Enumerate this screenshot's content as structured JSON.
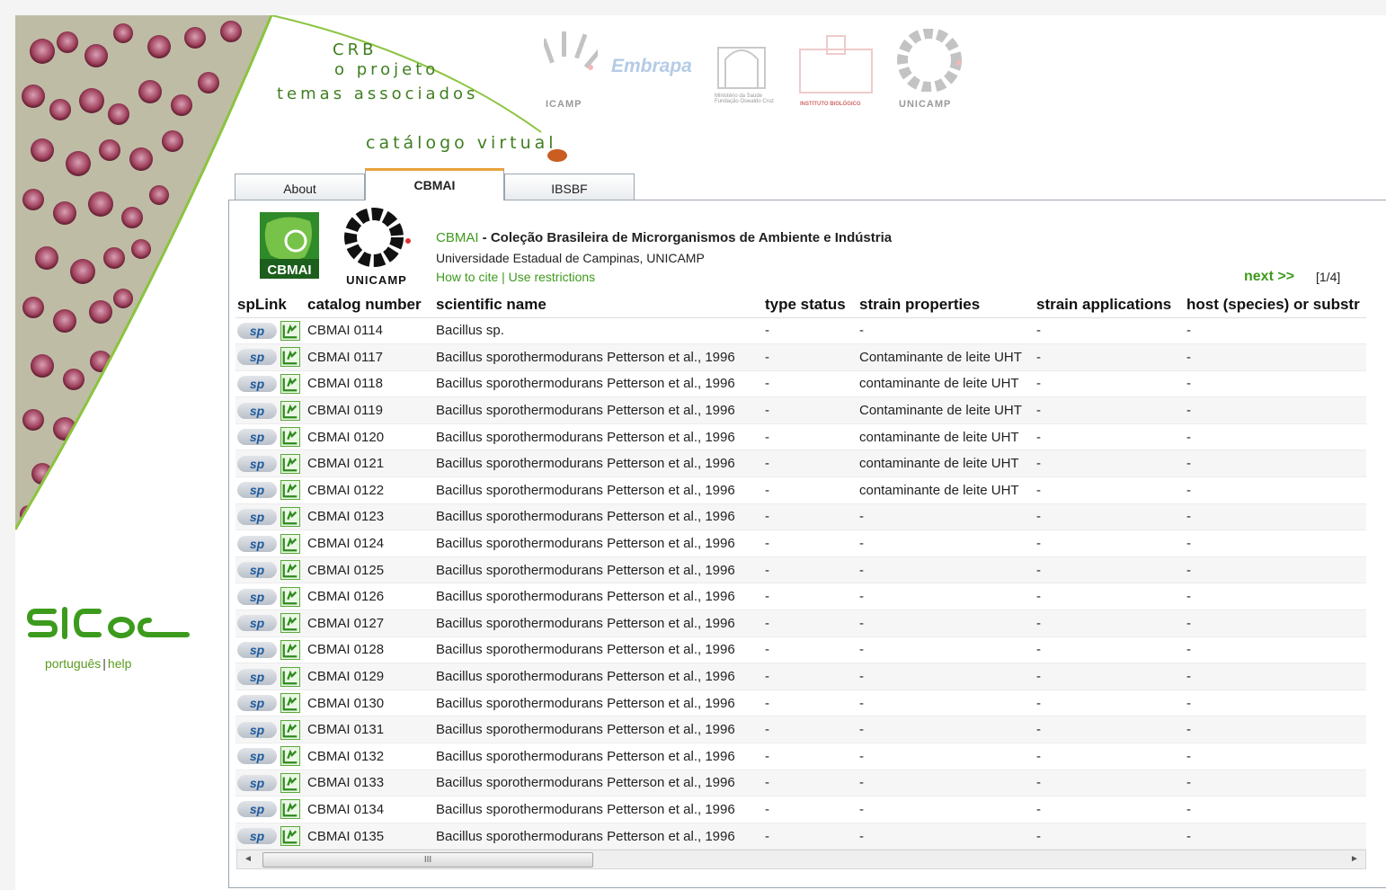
{
  "menu": {
    "crb": "CRB",
    "projeto": "o projeto",
    "temas": "temas associados",
    "catalogo": "catálogo virtual"
  },
  "partners": [
    {
      "name": "icamp",
      "label": "ICAMP"
    },
    {
      "name": "embrapa",
      "label": "Embrapa"
    },
    {
      "name": "ministerio-saude",
      "label": "Ministério da Saúde Fundação Oswaldo Cruz"
    },
    {
      "name": "instituto-biologico",
      "label": "INSTITUTO BIOLÓGICO"
    },
    {
      "name": "unicamp",
      "label": "UNICAMP"
    }
  ],
  "sidebar": {
    "logo_text": "SICol",
    "lang": "português",
    "help": "help",
    "sep": "|"
  },
  "tabs": [
    {
      "label": "About",
      "active": false
    },
    {
      "label": "CBMAI",
      "active": true
    },
    {
      "label": "IBSBF",
      "active": false
    }
  ],
  "collection": {
    "logo1": "CBMAI",
    "logo2": "UNICAMP",
    "acronym": "CBMAI",
    "title": " - Coleção Brasileira de Microrganismos de Ambiente e Indústria",
    "institution": "Universidade Estadual de Campinas, UNICAMP",
    "cite": "How to cite",
    "sep": "|",
    "restrictions": "Use restrictions",
    "next": "next >>",
    "page": "[1/4]"
  },
  "colors": {
    "accent": "#3f9a1c",
    "tab_highlight": "#e9a23b"
  },
  "table": {
    "headers": [
      "spLink",
      "catalog number",
      "scientific name",
      "type status",
      "strain properties",
      "strain applications",
      "host (species) or substr"
    ],
    "sp_label": "sp",
    "rows": [
      [
        "CBMAI 0114",
        "Bacillus sp.",
        "-",
        "-",
        "-",
        "-"
      ],
      [
        "CBMAI 0117",
        "Bacillus sporothermodurans Petterson et al., 1996",
        "-",
        "Contaminante de leite UHT",
        "-",
        "-"
      ],
      [
        "CBMAI 0118",
        "Bacillus sporothermodurans Petterson et al., 1996",
        "-",
        "contaminante de leite UHT",
        "-",
        "-"
      ],
      [
        "CBMAI 0119",
        "Bacillus sporothermodurans Petterson et al., 1996",
        "-",
        "Contaminante de leite UHT",
        "-",
        "-"
      ],
      [
        "CBMAI 0120",
        "Bacillus sporothermodurans Petterson et al., 1996",
        "-",
        "contaminante de leite UHT",
        "-",
        "-"
      ],
      [
        "CBMAI 0121",
        "Bacillus sporothermodurans Petterson et al., 1996",
        "-",
        "contaminante de leite UHT",
        "-",
        "-"
      ],
      [
        "CBMAI 0122",
        "Bacillus sporothermodurans Petterson et al., 1996",
        "-",
        "contaminante de leite UHT",
        "-",
        "-"
      ],
      [
        "CBMAI 0123",
        "Bacillus sporothermodurans Petterson et al., 1996",
        "-",
        "-",
        "-",
        "-"
      ],
      [
        "CBMAI 0124",
        "Bacillus sporothermodurans Petterson et al., 1996",
        "-",
        "-",
        "-",
        "-"
      ],
      [
        "CBMAI 0125",
        "Bacillus sporothermodurans Petterson et al., 1996",
        "-",
        "-",
        "-",
        "-"
      ],
      [
        "CBMAI 0126",
        "Bacillus sporothermodurans Petterson et al., 1996",
        "-",
        "-",
        "-",
        "-"
      ],
      [
        "CBMAI 0127",
        "Bacillus sporothermodurans Petterson et al., 1996",
        "-",
        "-",
        "-",
        "-"
      ],
      [
        "CBMAI 0128",
        "Bacillus sporothermodurans Petterson et al., 1996",
        "-",
        "-",
        "-",
        "-"
      ],
      [
        "CBMAI 0129",
        "Bacillus sporothermodurans Petterson et al., 1996",
        "-",
        "-",
        "-",
        "-"
      ],
      [
        "CBMAI 0130",
        "Bacillus sporothermodurans Petterson et al., 1996",
        "-",
        "-",
        "-",
        "-"
      ],
      [
        "CBMAI 0131",
        "Bacillus sporothermodurans Petterson et al., 1996",
        "-",
        "-",
        "-",
        "-"
      ],
      [
        "CBMAI 0132",
        "Bacillus sporothermodurans Petterson et al., 1996",
        "-",
        "-",
        "-",
        "-"
      ],
      [
        "CBMAI 0133",
        "Bacillus sporothermodurans Petterson et al., 1996",
        "-",
        "-",
        "-",
        "-"
      ],
      [
        "CBMAI 0134",
        "Bacillus sporothermodurans Petterson et al., 1996",
        "-",
        "-",
        "-",
        "-"
      ],
      [
        "CBMAI 0135",
        "Bacillus sporothermodurans Petterson et al., 1996",
        "-",
        "-",
        "-",
        "-"
      ]
    ]
  },
  "scrollbar": {
    "grip": "III",
    "left_arrow": "◄",
    "right_arrow": "►"
  }
}
